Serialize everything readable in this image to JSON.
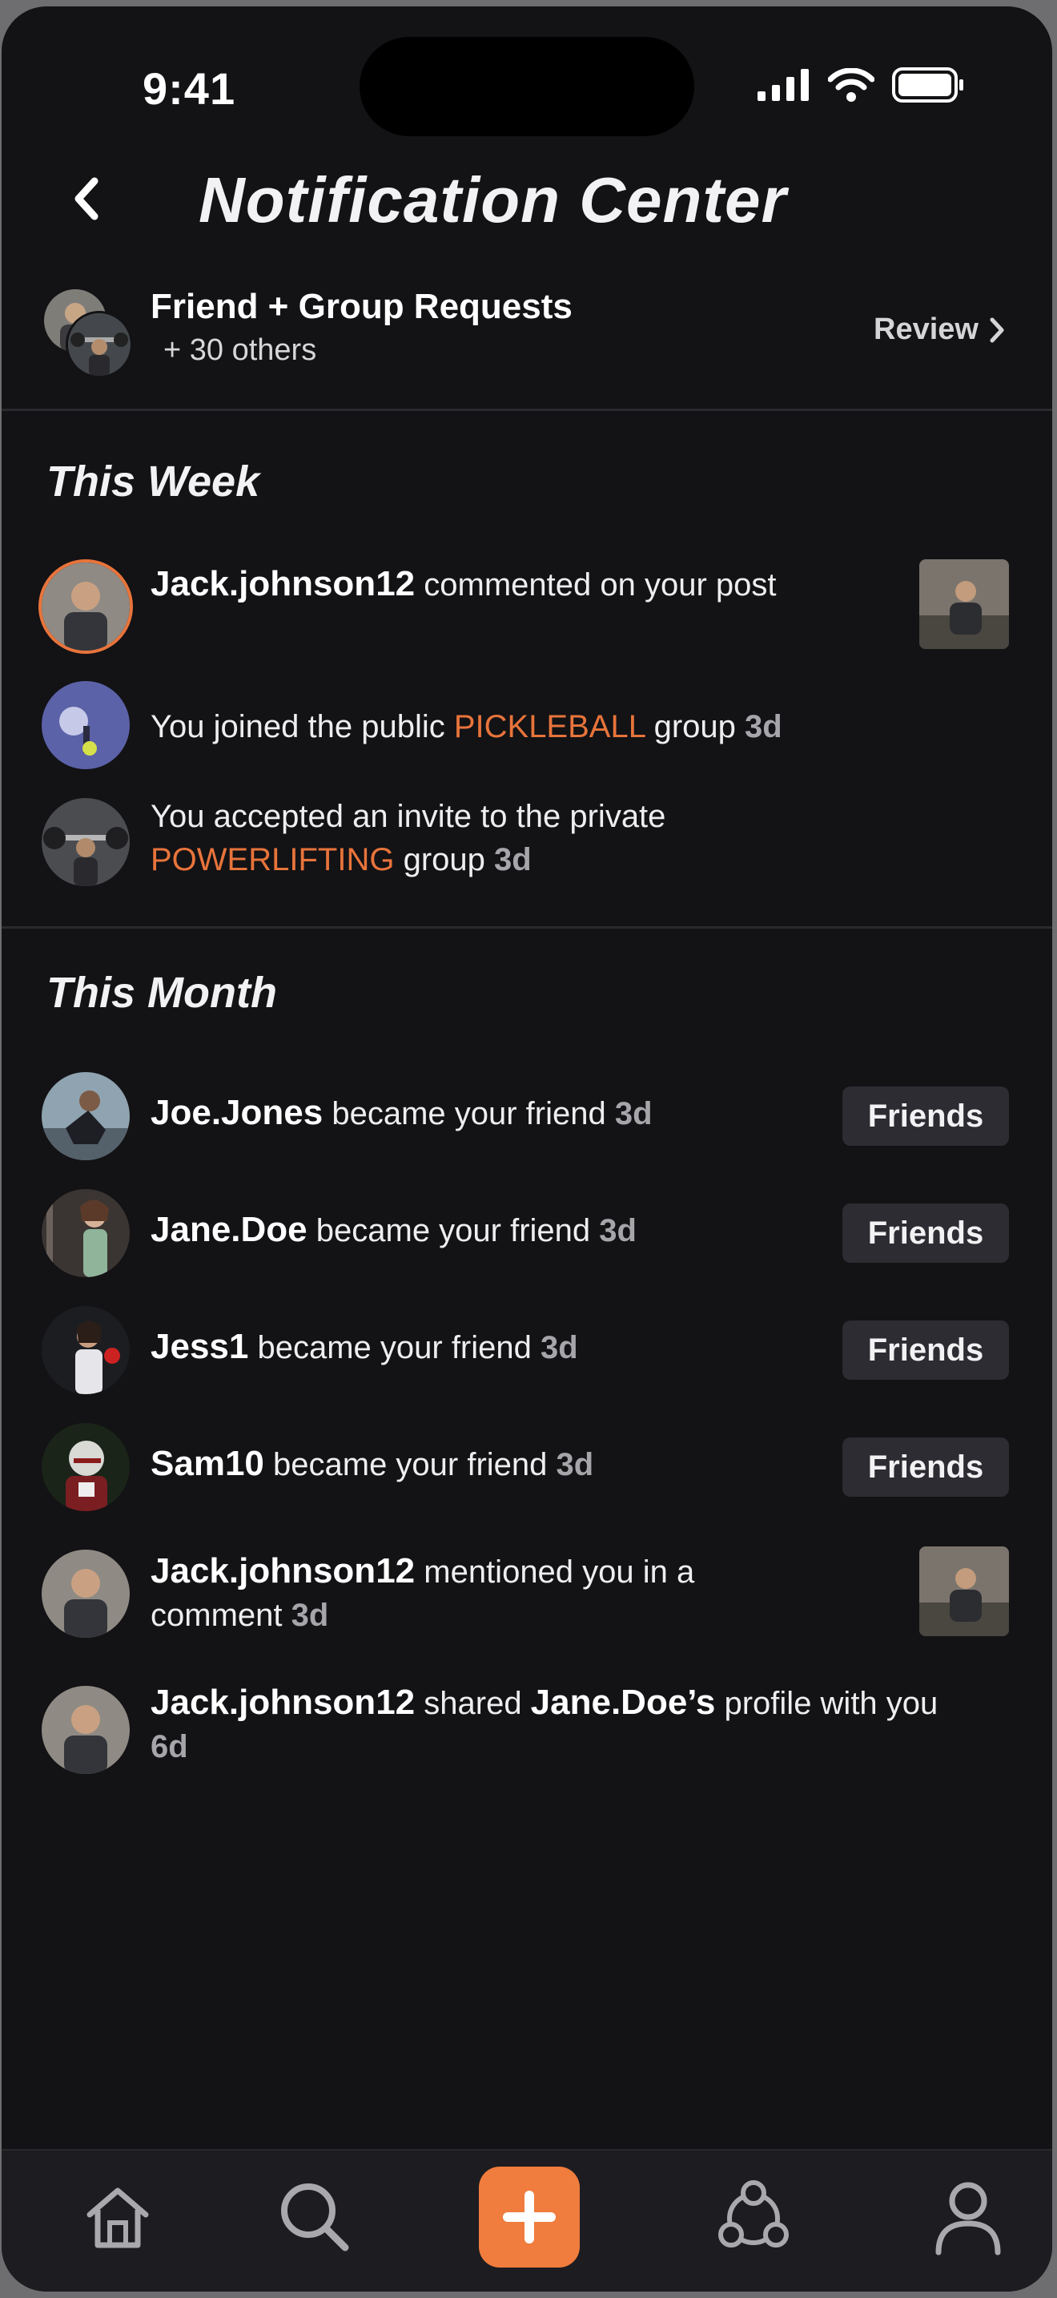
{
  "status_bar": {
    "time": "9:41"
  },
  "header": {
    "title": "Notification Center"
  },
  "requests": {
    "title": "Friend + Group Requests",
    "subtitle": "+ 30 others",
    "review_label": "Review"
  },
  "this_week": {
    "title": "This Week",
    "items": [
      {
        "user": "Jack.johnson12",
        "text": " commented on your post"
      },
      {
        "pre": "You joined the public ",
        "highlight": "PICKLEBALL",
        "post": " group ",
        "ago": "3d"
      },
      {
        "pre": "You accepted an invite to the private ",
        "highlight": "POWERLIFTING",
        "post": " group ",
        "ago": "3d"
      }
    ]
  },
  "this_month": {
    "title": "This Month",
    "friends_label": "Friends",
    "items": [
      {
        "user": "Joe.Jones",
        "text": " became your friend ",
        "ago": "3d"
      },
      {
        "user": "Jane.Doe",
        "text": " became your friend ",
        "ago": "3d"
      },
      {
        "user": "Jess1",
        "text": " became your friend ",
        "ago": "3d"
      },
      {
        "user": "Sam10",
        "text": " became your friend ",
        "ago": "3d"
      },
      {
        "user": "Jack.johnson12",
        "text": " mentioned you in a comment ",
        "ago": "3d"
      },
      {
        "user": "Jack.johnson12",
        "text": " shared ",
        "user2": "Jane.Doe’s",
        "text2": " profile with you ",
        "ago": "6d"
      }
    ]
  },
  "tabbar": {
    "items": [
      "home-icon",
      "search-icon",
      "plus-icon",
      "groups-icon",
      "profile-icon"
    ]
  },
  "colors": {
    "accent": "#e8743b",
    "background": "#131215"
  }
}
